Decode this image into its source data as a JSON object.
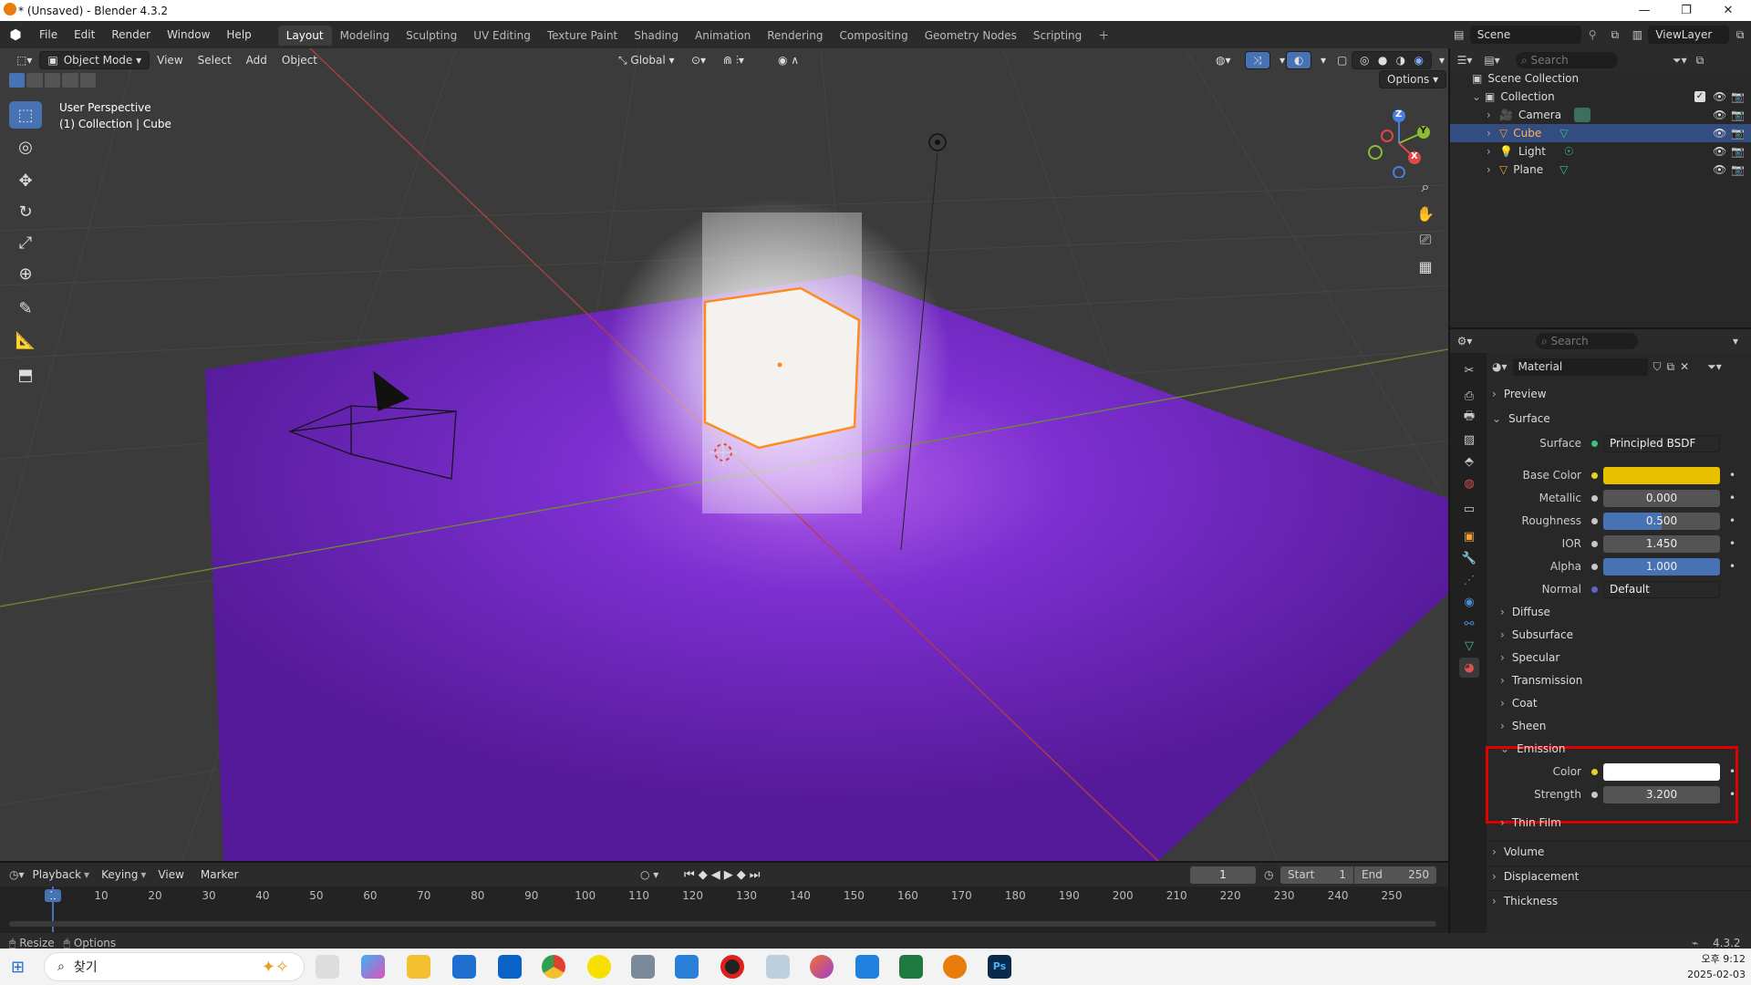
{
  "window": {
    "title": "* (Unsaved) - Blender 4.3.2"
  },
  "menu": [
    "File",
    "Edit",
    "Render",
    "Window",
    "Help"
  ],
  "workspaces": [
    {
      "label": "Layout",
      "active": true
    },
    {
      "label": "Modeling"
    },
    {
      "label": "Sculpting"
    },
    {
      "label": "UV Editing"
    },
    {
      "label": "Texture Paint"
    },
    {
      "label": "Shading"
    },
    {
      "label": "Animation"
    },
    {
      "label": "Rendering"
    },
    {
      "label": "Compositing"
    },
    {
      "label": "Geometry Nodes"
    },
    {
      "label": "Scripting"
    }
  ],
  "topright": {
    "scene": "Scene",
    "view_layer": "ViewLayer"
  },
  "viewport": {
    "mode": "Object Mode",
    "menus": [
      "View",
      "Select",
      "Add",
      "Object"
    ],
    "orientation": "Global",
    "options": "Options",
    "overlay_title": "User Perspective",
    "overlay_sub": "(1) Collection | Cube",
    "gizmo": {
      "z": "Z",
      "y": "Y",
      "x": "X"
    },
    "colors": {
      "plane": "#6a1fb0",
      "cube": "#f4f2ee",
      "select": "#ff8a1f"
    }
  },
  "outliner": {
    "search_placeholder": "Search",
    "root": "Scene Collection",
    "collection": "Collection",
    "items": [
      {
        "label": "Camera",
        "selected": false
      },
      {
        "label": "Cube",
        "selected": true
      },
      {
        "label": "Light",
        "selected": false
      },
      {
        "label": "Plane",
        "selected": false
      }
    ]
  },
  "properties": {
    "search_placeholder": "Search",
    "material_name": "Material",
    "preview": "Preview",
    "surface_section": "Surface",
    "surface_label": "Surface",
    "surface_value": "Principled BSDF",
    "fields": [
      {
        "label": "Base Color",
        "value": "",
        "color": "#e8c000"
      },
      {
        "label": "Metallic",
        "value": "0.000"
      },
      {
        "label": "Roughness",
        "value": "0.500"
      },
      {
        "label": "IOR",
        "value": "1.450"
      },
      {
        "label": "Alpha",
        "value": "1.000"
      },
      {
        "label": "Normal",
        "value": "Default"
      }
    ],
    "subsections": [
      "Diffuse",
      "Subsurface",
      "Specular",
      "Transmission",
      "Coat",
      "Sheen"
    ],
    "emission": {
      "label": "Emission",
      "color_label": "Color",
      "color": "#ffffff",
      "strength_label": "Strength",
      "strength": "3.200"
    },
    "after": [
      "Thin Film"
    ],
    "sections_after": [
      "Volume",
      "Displacement",
      "Thickness"
    ]
  },
  "timeline": {
    "menus": [
      "Playback",
      "Keying",
      "View",
      "Marker"
    ],
    "current_frame": "1",
    "start_label": "Start",
    "start": "1",
    "end_label": "End",
    "end": "250",
    "ticks": [
      "1",
      "10",
      "20",
      "30",
      "40",
      "50",
      "60",
      "70",
      "80",
      "90",
      "100",
      "110",
      "120",
      "130",
      "140",
      "150",
      "160",
      "170",
      "180",
      "190",
      "200",
      "210",
      "220",
      "230",
      "240",
      "250"
    ]
  },
  "status": {
    "left1": "Resize",
    "left2": "Options",
    "version": "4.3.2"
  },
  "taskbar": {
    "search": "찾기",
    "time": "오후 9:12",
    "date": "2025-02-03"
  }
}
